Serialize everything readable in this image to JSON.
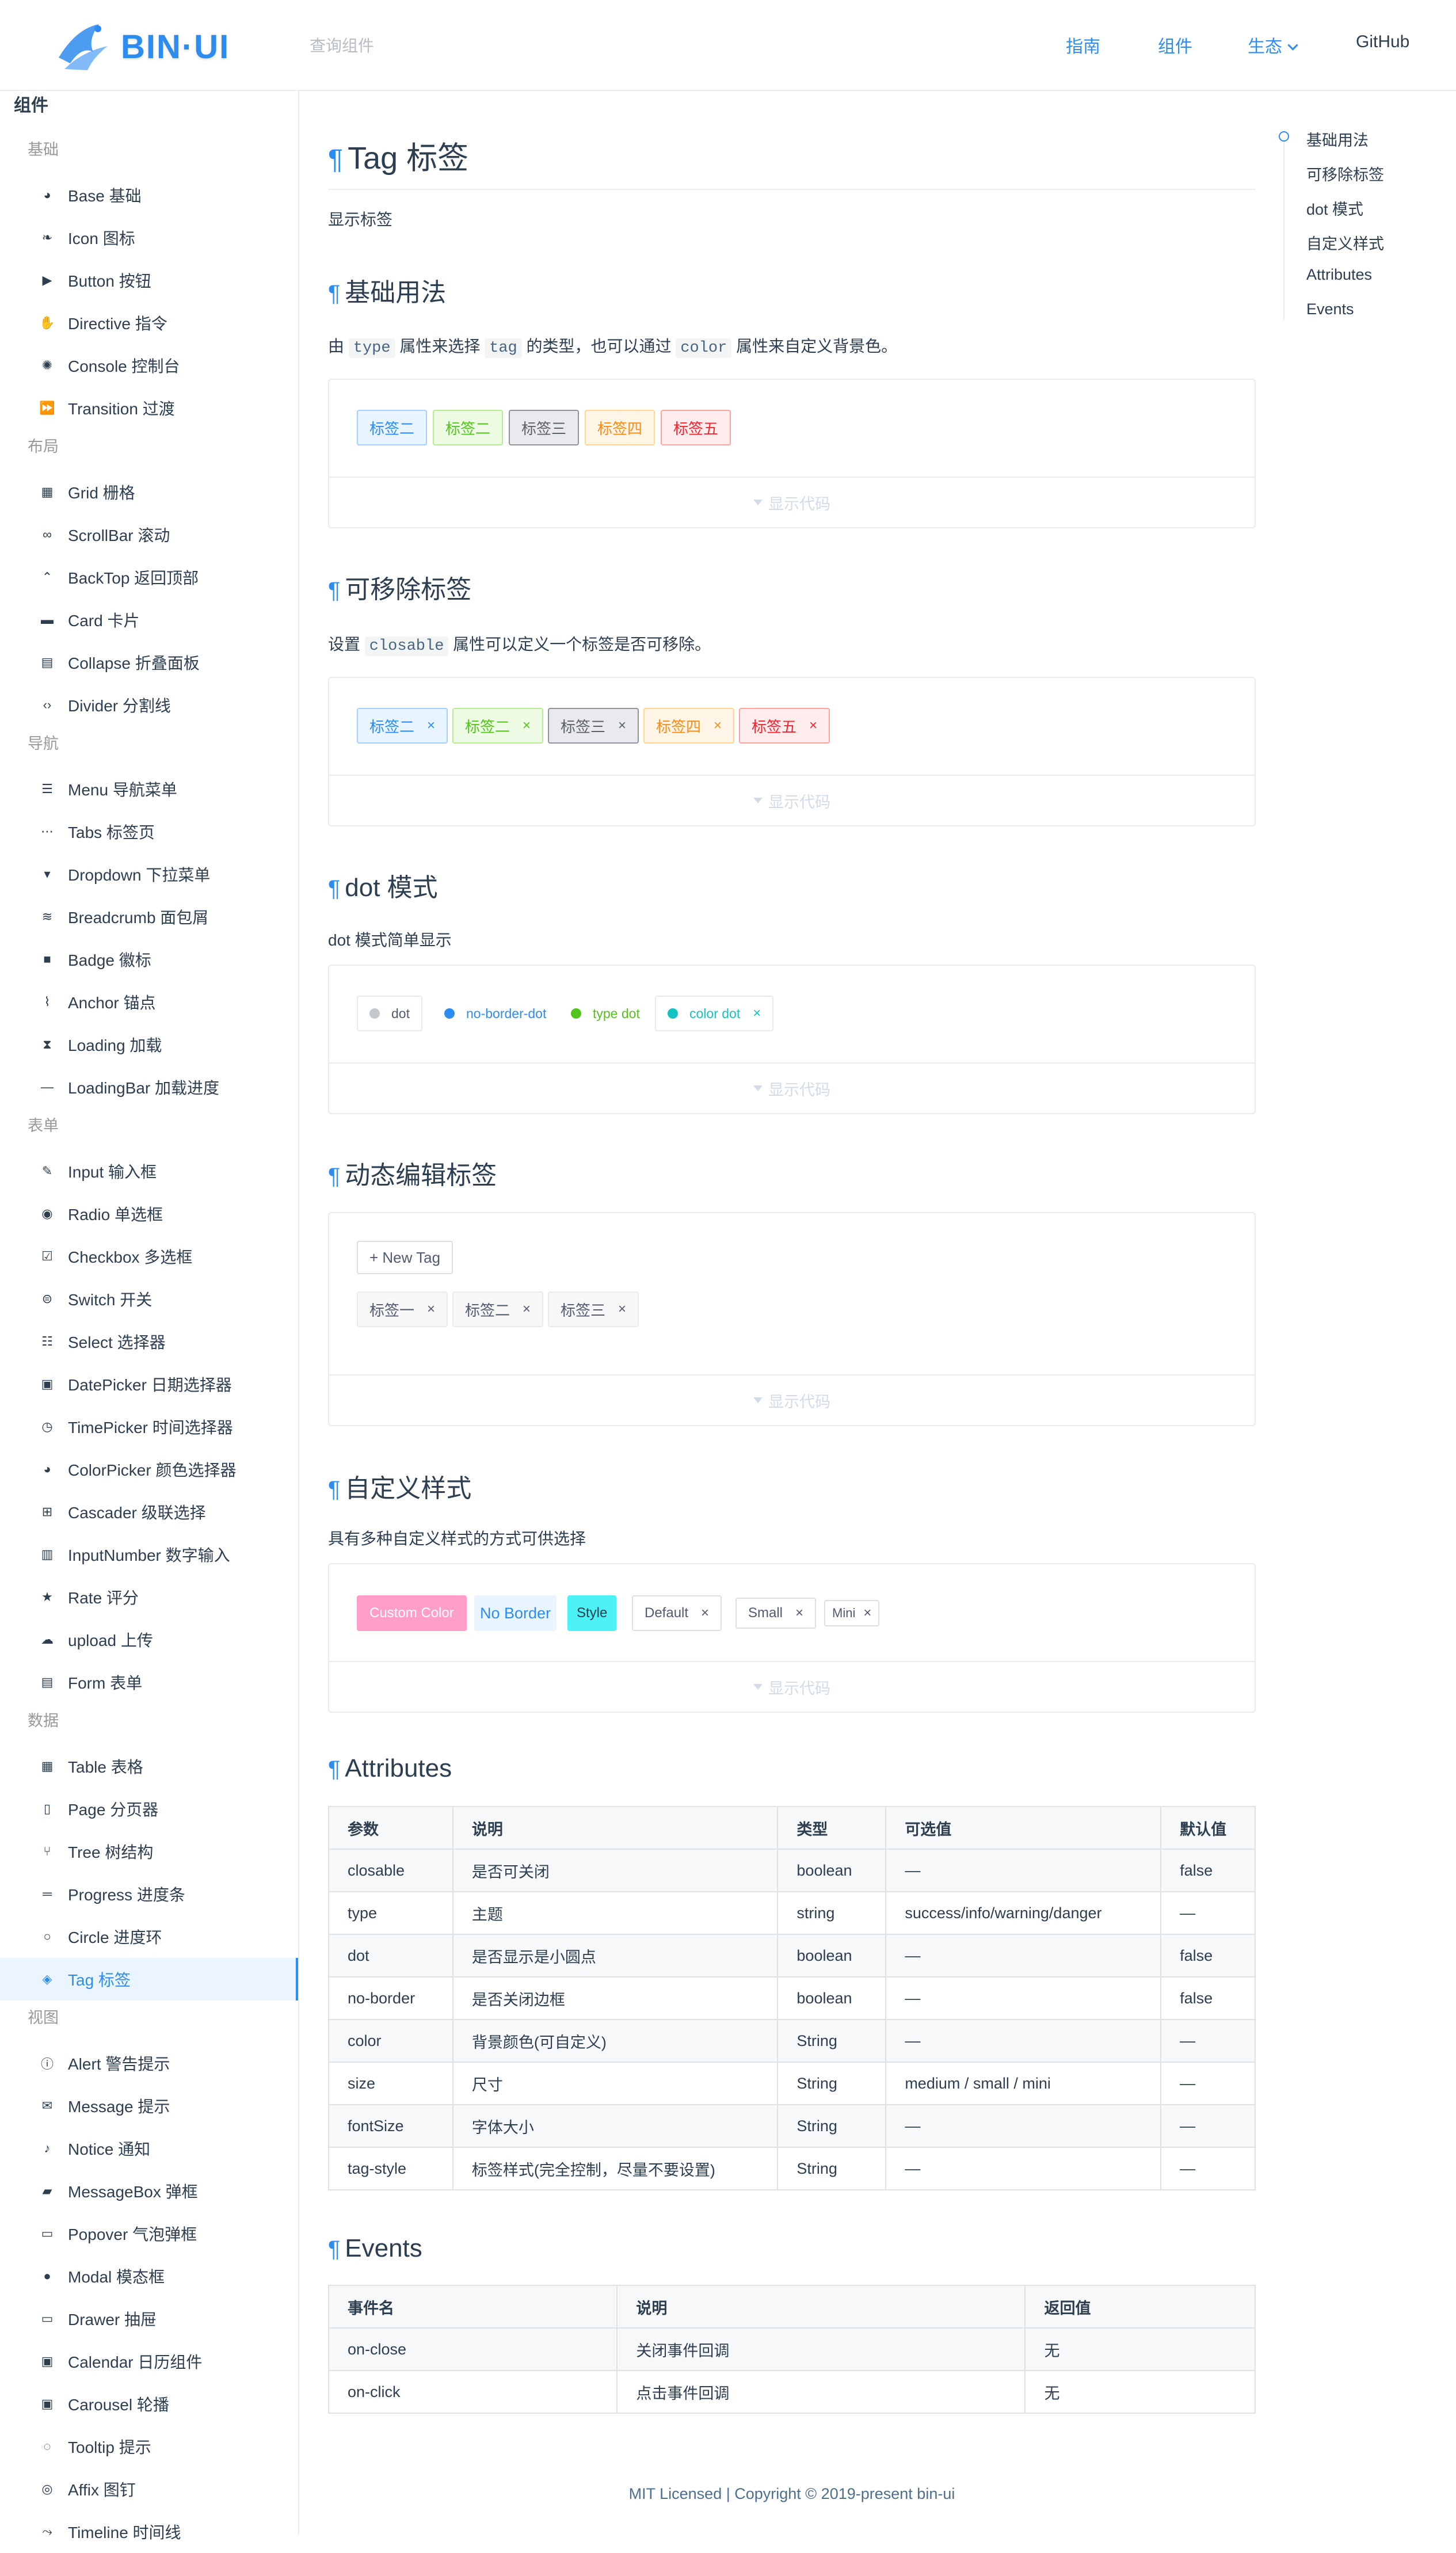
{
  "header": {
    "brand": "BIN·UI",
    "search_placeholder": "查询组件",
    "nav": [
      "指南",
      "组件",
      "生态",
      "GitHub"
    ]
  },
  "sidebar": {
    "title": "组件",
    "groups": [
      {
        "label": "基础",
        "items": [
          {
            "icon": "palette-icon",
            "label": "Base 基础"
          },
          {
            "icon": "leaf-icon",
            "label": "Icon 图标"
          },
          {
            "icon": "play-icon",
            "label": "Button 按钮"
          },
          {
            "icon": "hand-icon",
            "label": "Directive 指令"
          },
          {
            "icon": "bug-icon",
            "label": "Console 控制台"
          },
          {
            "icon": "fast-forward-icon",
            "label": "Transition 过渡"
          }
        ]
      },
      {
        "label": "布局",
        "items": [
          {
            "icon": "grid-icon",
            "label": "Grid 栅格"
          },
          {
            "icon": "infinity-icon",
            "label": "ScrollBar 滚动"
          },
          {
            "icon": "chevron-up-icon",
            "label": "BackTop 返回顶部"
          },
          {
            "icon": "card-icon",
            "label": "Card 卡片"
          },
          {
            "icon": "folder-icon",
            "label": "Collapse 折叠面板"
          },
          {
            "icon": "code-icon",
            "label": "Divider 分割线"
          }
        ]
      },
      {
        "label": "导航",
        "items": [
          {
            "icon": "menu-icon",
            "label": "Menu 导航菜单"
          },
          {
            "icon": "ellipsis-icon",
            "label": "Tabs 标签页"
          },
          {
            "icon": "caret-down-icon",
            "label": "Dropdown 下拉菜单"
          },
          {
            "icon": "layers-icon",
            "label": "Breadcrumb 面包屑"
          },
          {
            "icon": "square-icon",
            "label": "Badge 徽标"
          },
          {
            "icon": "paperclip-icon",
            "label": "Anchor 锚点"
          },
          {
            "icon": "hourglass-icon",
            "label": "Loading 加载"
          },
          {
            "icon": "minus-icon",
            "label": "LoadingBar 加载进度"
          }
        ]
      },
      {
        "label": "表单",
        "items": [
          {
            "icon": "edit-icon",
            "label": "Input 输入框"
          },
          {
            "icon": "radio-icon",
            "label": "Radio 单选框"
          },
          {
            "icon": "checkbox-icon",
            "label": "Checkbox 多选框"
          },
          {
            "icon": "toggle-icon",
            "label": "Switch 开关"
          },
          {
            "icon": "list-icon",
            "label": "Select 选择器"
          },
          {
            "icon": "calendar-icon",
            "label": "DatePicker 日期选择器"
          },
          {
            "icon": "clock-icon",
            "label": "TimePicker 时间选择器"
          },
          {
            "icon": "palette-icon",
            "label": "ColorPicker 颜色选择器"
          },
          {
            "icon": "cascader-icon",
            "label": "Cascader 级联选择"
          },
          {
            "icon": "calculator-icon",
            "label": "InputNumber 数字输入"
          },
          {
            "icon": "star-icon",
            "label": "Rate 评分"
          },
          {
            "icon": "cloud-upload-icon",
            "label": "upload 上传"
          },
          {
            "icon": "form-icon",
            "label": "Form 表单"
          }
        ]
      },
      {
        "label": "数据",
        "items": [
          {
            "icon": "table-icon",
            "label": "Table 表格"
          },
          {
            "icon": "book-icon",
            "label": "Page 分页器"
          },
          {
            "icon": "tree-icon",
            "label": "Tree 树结构"
          },
          {
            "icon": "progress-icon",
            "label": "Progress 进度条"
          },
          {
            "icon": "circle-icon",
            "label": "Circle 进度环"
          },
          {
            "icon": "tag-icon",
            "label": "Tag 标签",
            "active": true
          }
        ]
      },
      {
        "label": "视图",
        "items": [
          {
            "icon": "info-icon",
            "label": "Alert 警告提示"
          },
          {
            "icon": "mail-icon",
            "label": "Message 提示"
          },
          {
            "icon": "bell-icon",
            "label": "Notice 通知"
          },
          {
            "icon": "chat-icon",
            "label": "MessageBox 弹框"
          },
          {
            "icon": "popover-icon",
            "label": "Popover 气泡弹框"
          },
          {
            "icon": "speech-icon",
            "label": "Modal 模态框"
          },
          {
            "icon": "drawer-icon",
            "label": "Drawer 抽屉"
          },
          {
            "icon": "calendar-icon",
            "label": "Calendar 日历组件"
          },
          {
            "icon": "carousel-icon",
            "label": "Carousel 轮播"
          },
          {
            "icon": "tooltip-icon",
            "label": "Tooltip 提示"
          },
          {
            "icon": "pin-icon",
            "label": "Affix 图钉"
          },
          {
            "icon": "timeline-icon",
            "label": "Timeline 时间线"
          }
        ]
      }
    ]
  },
  "toc": [
    "基础用法",
    "可移除标签",
    "dot 模式",
    "自定义样式",
    "Attributes",
    "Events"
  ],
  "page": {
    "pilcrow": "¶",
    "title": "Tag 标签",
    "intro": "显示标签",
    "show_code": "显示代码",
    "sections": {
      "basic": {
        "title": "基础用法",
        "desc_parts": [
          "由 ",
          "type",
          " 属性来选择 ",
          "tag",
          " 的类型，也可以通过 ",
          "color",
          " 属性来自定义背景色。"
        ],
        "tags": [
          {
            "label": "标签二",
            "type": "primary"
          },
          {
            "label": "标签二",
            "type": "success"
          },
          {
            "label": "标签三",
            "type": "info"
          },
          {
            "label": "标签四",
            "type": "warning"
          },
          {
            "label": "标签五",
            "type": "danger"
          }
        ]
      },
      "closable": {
        "title": "可移除标签",
        "desc_parts": [
          "设置 ",
          "closable",
          " 属性可以定义一个标签是否可移除。"
        ],
        "tags": [
          {
            "label": "标签二",
            "type": "primary"
          },
          {
            "label": "标签二",
            "type": "success"
          },
          {
            "label": "标签三",
            "type": "info"
          },
          {
            "label": "标签四",
            "type": "warning"
          },
          {
            "label": "标签五",
            "type": "danger"
          }
        ],
        "close_glyph": "×"
      },
      "dot": {
        "title": "dot 模式",
        "desc": "dot 模式简单显示",
        "tags": [
          {
            "label": "dot",
            "dot_color": "#c5c8ce",
            "text_color": "#515a6e",
            "border": true
          },
          {
            "label": "no-border-dot",
            "dot_color": "#2d8cf0",
            "text_color": "#2d8cf0",
            "border": false
          },
          {
            "label": "type dot",
            "dot_color": "#52c41a",
            "text_color": "#52c41a",
            "border": false
          },
          {
            "label": "color dot",
            "dot_color": "#13c2c2",
            "text_color": "#13c2c2",
            "border": true,
            "closable": true
          }
        ]
      },
      "dynamic": {
        "title": "动态编辑标签",
        "new_tag": "+ New Tag",
        "tags": [
          "标签一",
          "标签二",
          "标签三"
        ]
      },
      "custom": {
        "title": "自定义样式",
        "desc": "具有多种自定义样式的方式可供选择",
        "tags": [
          {
            "label": "Custom Color"
          },
          {
            "label": "No Border"
          },
          {
            "label": "Style"
          },
          {
            "label": "Default"
          },
          {
            "label": "Small"
          },
          {
            "label": "Mini"
          }
        ]
      },
      "attributes": {
        "title": "Attributes",
        "headers": [
          "参数",
          "说明",
          "类型",
          "可选值",
          "默认值"
        ],
        "rows": [
          [
            "closable",
            "是否可关闭",
            "boolean",
            "—",
            "false"
          ],
          [
            "type",
            "主题",
            "string",
            "success/info/warning/danger",
            "—"
          ],
          [
            "dot",
            "是否显示是小圆点",
            "boolean",
            "—",
            "false"
          ],
          [
            "no-border",
            "是否关闭边框",
            "boolean",
            "—",
            "false"
          ],
          [
            "color",
            "背景颜色(可自定义)",
            "String",
            "—",
            "—"
          ],
          [
            "size",
            "尺寸",
            "String",
            "medium / small / mini",
            "—"
          ],
          [
            "fontSize",
            "字体大小",
            "String",
            "—",
            "—"
          ],
          [
            "tag-style",
            "标签样式(完全控制，尽量不要设置)",
            "String",
            "—",
            "—"
          ]
        ]
      },
      "events": {
        "title": "Events",
        "headers": [
          "事件名",
          "说明",
          "返回值"
        ],
        "rows": [
          [
            "on-close",
            "关闭事件回调",
            "无"
          ],
          [
            "on-click",
            "点击事件回调",
            "无"
          ]
        ]
      }
    },
    "footer": "MIT Licensed | Copyright © 2019-present bin-ui"
  },
  "colors": {
    "accent": "#2d8cf0",
    "custom_color": "#ff9ec9",
    "style_cyan": "#4cf2f5"
  }
}
